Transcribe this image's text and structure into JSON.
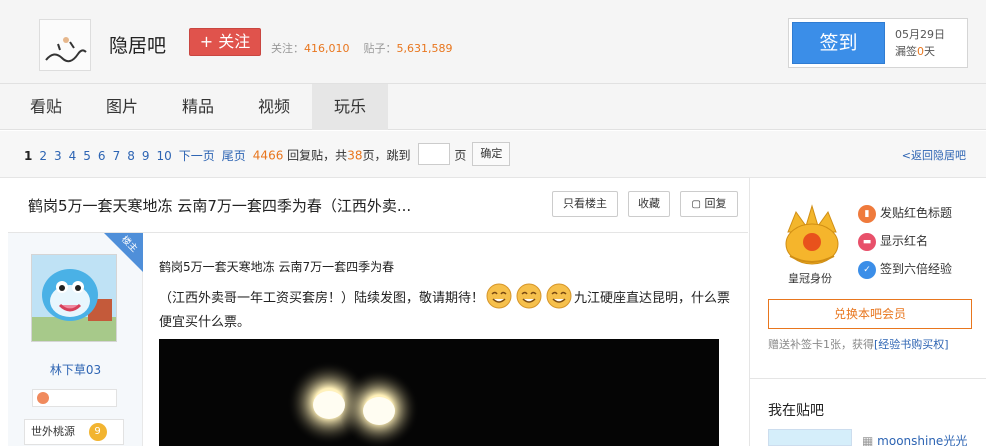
{
  "header": {
    "forum_name": "隐居吧",
    "follow_label": "+ 关注",
    "followers_label": "关注：",
    "followers_value": "416,010",
    "posts_label": "贴子：",
    "posts_value": "5,631,589",
    "signin_label": "签到",
    "sign_date": "05月29日",
    "missed_prefix": "漏签",
    "missed_value": "0",
    "missed_suffix": "天"
  },
  "nav": {
    "tabs": [
      "看贴",
      "图片",
      "精品",
      "视频",
      "玩乐"
    ],
    "active": "玩乐"
  },
  "pager": {
    "pages": [
      "1",
      "2",
      "3",
      "4",
      "5",
      "6",
      "7",
      "8",
      "9",
      "10"
    ],
    "current": "1",
    "next_label": "下一页",
    "last_label": "尾页",
    "replies_value": "4466",
    "replies_label": "回复贴，共",
    "total_pages": "38",
    "page_unit": "页，跳到",
    "page_word": "页",
    "confirm_label": "确定",
    "back_label": "<返回隐居吧"
  },
  "post": {
    "title": "鹤岗5万一套天寒地冻 云南7万一套四季为春（江西外卖...",
    "only_op_label": "只看楼主",
    "favorite_label": "收藏",
    "reply_label": "回复",
    "op_badge": "楼主",
    "author": "林下草03",
    "level_name": "世外桃源",
    "level_num": "9",
    "line1": "鹤岗5万一套天寒地冻 云南7万一套四季为春",
    "line2_a": "（江西外卖哥一年工资买套房！）陆续发图，敬请期待！",
    "line2_b": "九江硬座直达昆明，什么票便宜买什么票。"
  },
  "sidebar": {
    "crown_label": "皇冠身份",
    "perks": [
      "发贴红色标题",
      "显示红名",
      "签到六倍经验"
    ],
    "exchange_label": "兑换本吧会员",
    "bonus_text": "赠送补签卡1张，获得",
    "bonus_link": "[经验书购买权]",
    "mybar_title": "我在贴吧",
    "mybar_user": "moonshine光光"
  },
  "colors": {
    "accent_blue": "#3b8ee8",
    "follow_red": "#e0534c",
    "number_orange": "#e8761e",
    "link_blue": "#2d64b3"
  }
}
